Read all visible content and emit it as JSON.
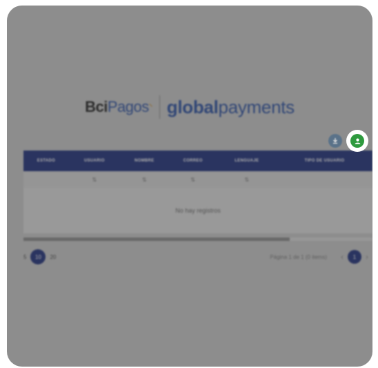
{
  "logos": {
    "bci_prefix": "Bci",
    "bci_suffix": "Pagos",
    "gp_bold": "global",
    "gp_regular": "payments"
  },
  "table": {
    "headers": [
      "ESTADO",
      "USUARIO",
      "NOMBRE",
      "CORREO",
      "LENGUAJE",
      "TIPO DE USUARIO"
    ],
    "filters": [
      "",
      "⇅",
      "⇅",
      "⇅",
      "⇅",
      ""
    ],
    "empty_message": "No hay registros"
  },
  "pager": {
    "sizes": [
      "5",
      "10",
      "20"
    ],
    "active_size": "10",
    "info": "Página 1 de 1 (0 items)",
    "current_page": "1",
    "prev": "‹",
    "next": "›"
  },
  "icons": {
    "download": "download-icon",
    "add_user": "add-user-icon"
  },
  "colors": {
    "header_bg": "#1e2f7a",
    "add_button": "#2e9a3e",
    "download_button": "#4a6a88"
  }
}
